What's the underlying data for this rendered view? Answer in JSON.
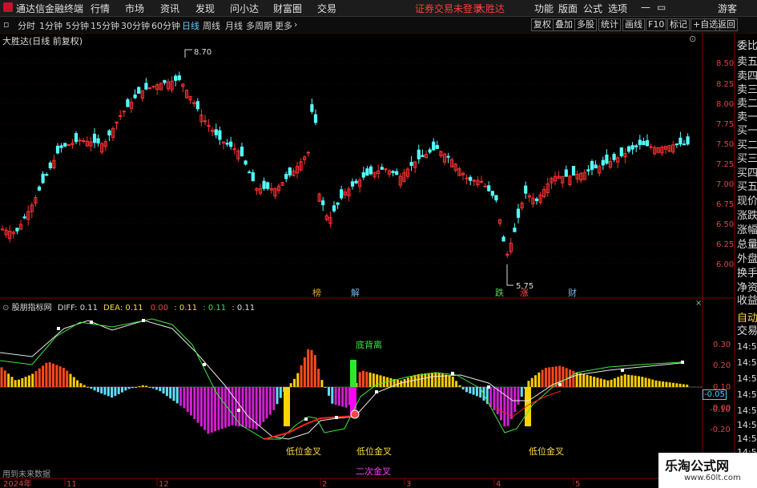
{
  "menu": {
    "app_title": "通达信金融终端",
    "items": [
      "行情",
      "市场",
      "资讯",
      "发现",
      "问小达",
      "财富圈",
      "交易"
    ],
    "login_notice": "证券交易未登录",
    "stock_name": "大胜达",
    "right_items": [
      "功能",
      "版面",
      "公式",
      "选项"
    ],
    "guest": "游客"
  },
  "toolbar": {
    "periods": [
      "分时",
      "1分钟",
      "5分钟",
      "15分钟",
      "30分钟",
      "60分钟",
      "日线",
      "周线",
      "月线",
      "多周期",
      "更多"
    ],
    "active_period": "日线",
    "right_buttons": [
      "复权",
      "叠加",
      "多股",
      "统计",
      "画线",
      "F10",
      "标记",
      "+自选",
      "返回"
    ]
  },
  "main_chart": {
    "title": "大胜达(日线 前复权)",
    "high_label": "8.70",
    "low_label": "5.75",
    "y_ticks": [
      "8.50",
      "8.25",
      "8.00",
      "7.75",
      "7.50",
      "7.25",
      "7.00",
      "6.75",
      "6.50",
      "6.25",
      "6.00"
    ],
    "event_markers": [
      {
        "text": "榜",
        "color": "#e8a23a"
      },
      {
        "text": "解",
        "color": "#6fb8e8"
      },
      {
        "text": "跌",
        "color": "#5fd35f"
      },
      {
        "text": "涨",
        "color": "#ff4d4d"
      },
      {
        "text": "财",
        "color": "#6fb8e8"
      }
    ]
  },
  "indicator": {
    "name": "股朋指标网",
    "diff_label": "DIFF: 0.11",
    "dea_label": "DEA: 0.11",
    "v1": "0.00",
    "v2": ": 0.11",
    "v3": ": 0.11",
    "v4": ": 0.11",
    "y_ticks": [
      "0.30",
      "0.20",
      "0.10",
      "0.00",
      "-0.05",
      "-0.10",
      "-0.20"
    ],
    "annotation_top": "底背离",
    "annotation_cross": "低位金叉",
    "annotation_second": "二次金叉",
    "future_data_note": "用到未来数据",
    "watermark": "乐淘公式网",
    "watermark_url": "www.60lt.com"
  },
  "side_panel": {
    "items": [
      "委比",
      "卖五",
      "卖四",
      "卖三",
      "卖二",
      "卖一",
      "买一",
      "买二",
      "买三",
      "买四",
      "买五",
      "现价",
      "涨跌",
      "涨幅",
      "总量",
      "外盘",
      "换手",
      "净资",
      "收益"
    ],
    "tabs": [
      "自动",
      "交易"
    ],
    "times": [
      "14:56",
      "14:56",
      "14:56",
      "14:56",
      "14:56",
      "14:56",
      "14:56",
      "14:56"
    ]
  },
  "date_axis": {
    "labels": [
      "2024年",
      "11",
      "12",
      "2",
      "3",
      "4",
      "5"
    ]
  },
  "colors": {
    "up": "#ff3232",
    "down": "#54ffff",
    "bg": "#000000",
    "grid": "#7a0000"
  }
}
